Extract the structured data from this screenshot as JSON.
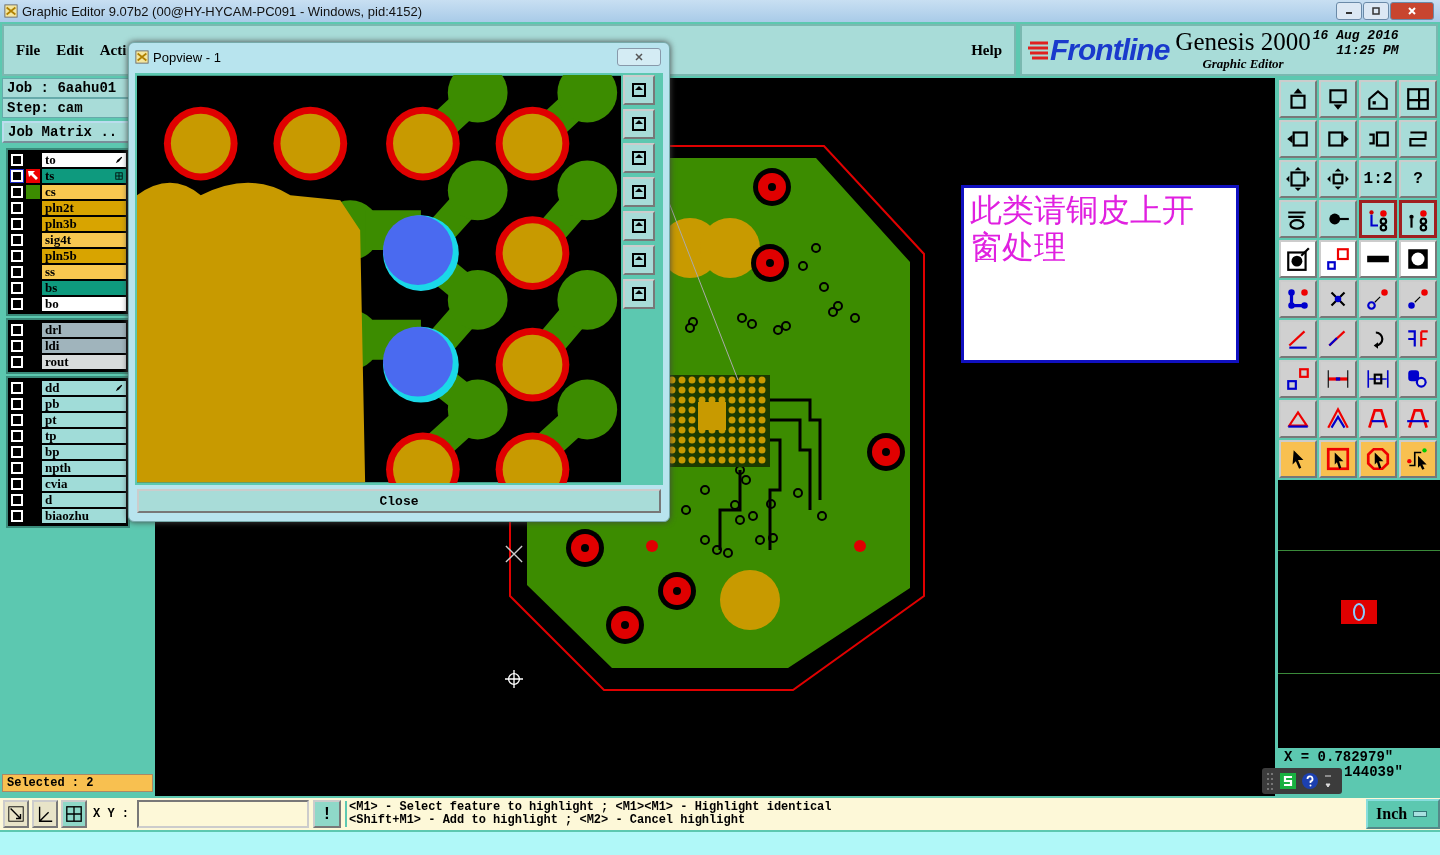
{
  "window": {
    "title": "Graphic Editor 9.07b2 (00@HY-HYCAM-PC091 - Windows, pid:4152)"
  },
  "menu": [
    "File",
    "Edit",
    "Acti"
  ],
  "help": "Help",
  "brand": {
    "logo": "Frontline",
    "product": "Genesis 2000",
    "subtitle": "Graphic Editor",
    "date": "16 Aug 2016",
    "time": "11:25 PM"
  },
  "job": {
    "job": "Job : 6aahu01",
    "step": "Step: cam",
    "matrix_button": "Job Matrix .."
  },
  "layer_groups": [
    {
      "layers": [
        {
          "name": "to",
          "color": "#ffffff",
          "checked": false,
          "selected": false,
          "kind": "pen"
        },
        {
          "name": "ts",
          "color": "#0e9a7e",
          "checked": false,
          "selected": true,
          "kind": "grid"
        },
        {
          "name": "cs",
          "color": "#f8c850",
          "checked": false,
          "selected": false,
          "swatch": true
        },
        {
          "name": "pln2t",
          "color": "#d8a400",
          "checked": false,
          "selected": false
        },
        {
          "name": "pln3b",
          "color": "#d8a400",
          "checked": false,
          "selected": false
        },
        {
          "name": "sig4t",
          "color": "#f8c850",
          "checked": false,
          "selected": false
        },
        {
          "name": "pln5b",
          "color": "#d8a400",
          "checked": false,
          "selected": false
        },
        {
          "name": "ss",
          "color": "#f8c850",
          "checked": false,
          "selected": false
        },
        {
          "name": "bs",
          "color": "#0e9a7e",
          "checked": false,
          "selected": false
        },
        {
          "name": "bo",
          "color": "#ffffff",
          "checked": false,
          "selected": false
        }
      ]
    },
    {
      "layers": [
        {
          "name": "drl",
          "color": "#a0b4bc",
          "checked": false,
          "selected": false
        },
        {
          "name": "ldi",
          "color": "#a0b4bc",
          "checked": false,
          "selected": false
        },
        {
          "name": "rout",
          "color": "#d8dcdc",
          "checked": false,
          "selected": false
        }
      ]
    },
    {
      "layers": [
        {
          "name": "dd",
          "color": "#a0dcd8",
          "checked": false,
          "selected": false,
          "kind": "pen"
        },
        {
          "name": "pb",
          "color": "#a0dcd8",
          "checked": false,
          "selected": false
        },
        {
          "name": "pt",
          "color": "#a0dcd8",
          "checked": false,
          "selected": false
        },
        {
          "name": "tp",
          "color": "#a0dcd8",
          "checked": false,
          "selected": false
        },
        {
          "name": "bp",
          "color": "#a0dcd8",
          "checked": false,
          "selected": false
        },
        {
          "name": "npth",
          "color": "#a0dcd8",
          "checked": false,
          "selected": false
        },
        {
          "name": "cvia",
          "color": "#a0dcd8",
          "checked": false,
          "selected": false
        },
        {
          "name": "d",
          "color": "#a0dcd8",
          "checked": false,
          "selected": false
        },
        {
          "name": "biaozhu",
          "color": "#a0dcd8",
          "checked": false,
          "selected": false
        }
      ]
    }
  ],
  "selected_count": "Selected : 2",
  "popview": {
    "title": "Popview - 1",
    "close": "Close"
  },
  "annotation": {
    "text": "此类请铜皮上开窗处理"
  },
  "toolbar": [
    {
      "selected": false
    },
    {
      "selected": false
    },
    {
      "selected": false
    },
    {
      "selected": false
    },
    {
      "selected": false
    },
    {
      "selected": false
    },
    {
      "selected": false
    },
    {
      "selected": false
    },
    {
      "selected": false
    },
    {
      "selected": false
    },
    {
      "selected": false,
      "label": "1:2"
    },
    {
      "selected": false,
      "label": "?"
    },
    {
      "selected": false
    },
    {
      "selected": false
    },
    {
      "selected": true
    },
    {
      "selected": true
    },
    {
      "selected": false
    },
    {
      "selected": false
    },
    {
      "selected": false
    },
    {
      "selected": false
    },
    {
      "selected": false
    },
    {
      "selected": false
    },
    {
      "selected": false
    },
    {
      "selected": false
    },
    {
      "selected": false
    },
    {
      "selected": false
    },
    {
      "selected": false
    },
    {
      "selected": false
    },
    {
      "selected": false
    },
    {
      "selected": false
    },
    {
      "selected": false
    },
    {
      "selected": false
    },
    {
      "selected": false
    },
    {
      "selected": false
    },
    {
      "selected": false
    },
    {
      "selected": false
    },
    {
      "selected": false
    },
    {
      "selected": false
    },
    {
      "selected": false
    },
    {
      "selected": false
    }
  ],
  "coords": {
    "x": "X = 0.782979\"",
    "y": "144039\""
  },
  "bottom": {
    "xy_label": "X Y :",
    "alert": "!",
    "messages": [
      "<M1> - Select feature to highlight ; <M1><M1> - Highlight identical",
      "<Shift+M1> - Add to highlight ; <M2> - Cancel highlight"
    ],
    "units": "Inch"
  }
}
